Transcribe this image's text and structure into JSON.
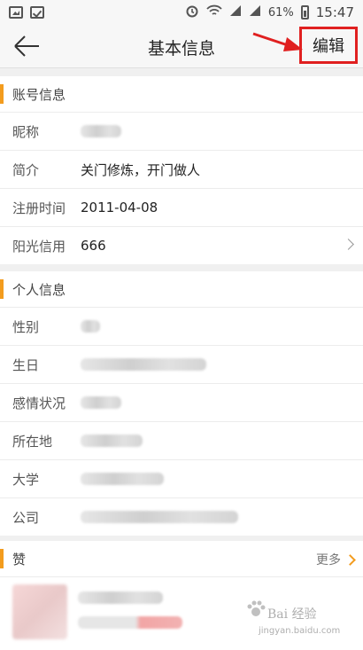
{
  "status_bar": {
    "battery": "61%",
    "time": "15:47"
  },
  "header": {
    "title": "基本信息",
    "edit_label": "编辑"
  },
  "account_section": {
    "title": "账号信息",
    "rows": [
      {
        "label": "昵称",
        "value": ""
      },
      {
        "label": "简介",
        "value": "关门修炼，开门做人"
      },
      {
        "label": "注册时间",
        "value": "2011-04-08"
      },
      {
        "label": "阳光信用",
        "value": "666"
      }
    ]
  },
  "personal_section": {
    "title": "个人信息",
    "rows": [
      {
        "label": "性别"
      },
      {
        "label": "生日"
      },
      {
        "label": "感情状况"
      },
      {
        "label": "所在地"
      },
      {
        "label": "大学"
      },
      {
        "label": "公司"
      }
    ]
  },
  "likes_section": {
    "title": "赞",
    "more_label": "更多"
  },
  "watermark": {
    "text": "Bai 经验",
    "url": "jingyan.baidu.com"
  },
  "colors": {
    "accent": "#f39c1e",
    "highlight": "#e02020"
  }
}
